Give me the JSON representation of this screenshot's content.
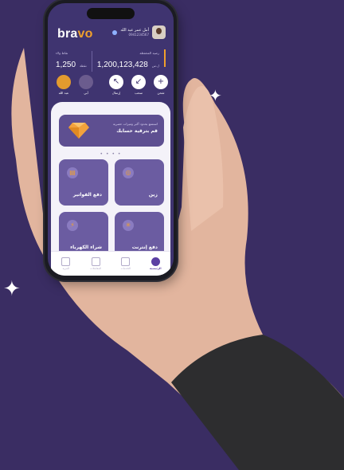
{
  "app": {
    "logo_main": "bra",
    "logo_accent": "vo"
  },
  "user": {
    "name": "أمل عمر عبد الله",
    "phone": "0941234567"
  },
  "balances": {
    "main": {
      "label": "رصيد المحفظة",
      "value": "1,200,123,428",
      "currency": "ل.س"
    },
    "points": {
      "label": "نقاط ولاء",
      "value": "1,250",
      "unit": "نقطة"
    }
  },
  "actions": [
    {
      "label": "شحن",
      "icon": "plus-icon"
    },
    {
      "label": "سحب",
      "icon": "arrow-down-left-icon"
    },
    {
      "label": "إرسال",
      "icon": "arrow-up-left-icon"
    }
  ],
  "contacts": [
    {
      "label": "أبي"
    },
    {
      "label": "عبد الله"
    }
  ],
  "banner": {
    "line1": "استمتع بحدود أكبر وميزات حصرية",
    "line2": "قم بترقية حسابك"
  },
  "tiles": [
    {
      "label": "زين",
      "icon": "zain-icon"
    },
    {
      "label": "دفع الفواتير",
      "icon": "bill-icon"
    },
    {
      "label": "دفع إنترنت",
      "icon": "internet-icon"
    },
    {
      "label": "شراء الكهرباء",
      "icon": "electricity-icon"
    }
  ],
  "nav": [
    {
      "label": "الرئيسية",
      "active": true
    },
    {
      "label": "الخدمات",
      "active": false
    },
    {
      "label": "المعاملات",
      "active": false
    },
    {
      "label": "المزيد",
      "active": false
    }
  ],
  "colors": {
    "background": "#3a2d63",
    "accent": "#f0a02c",
    "primary": "#5b3fa3"
  }
}
